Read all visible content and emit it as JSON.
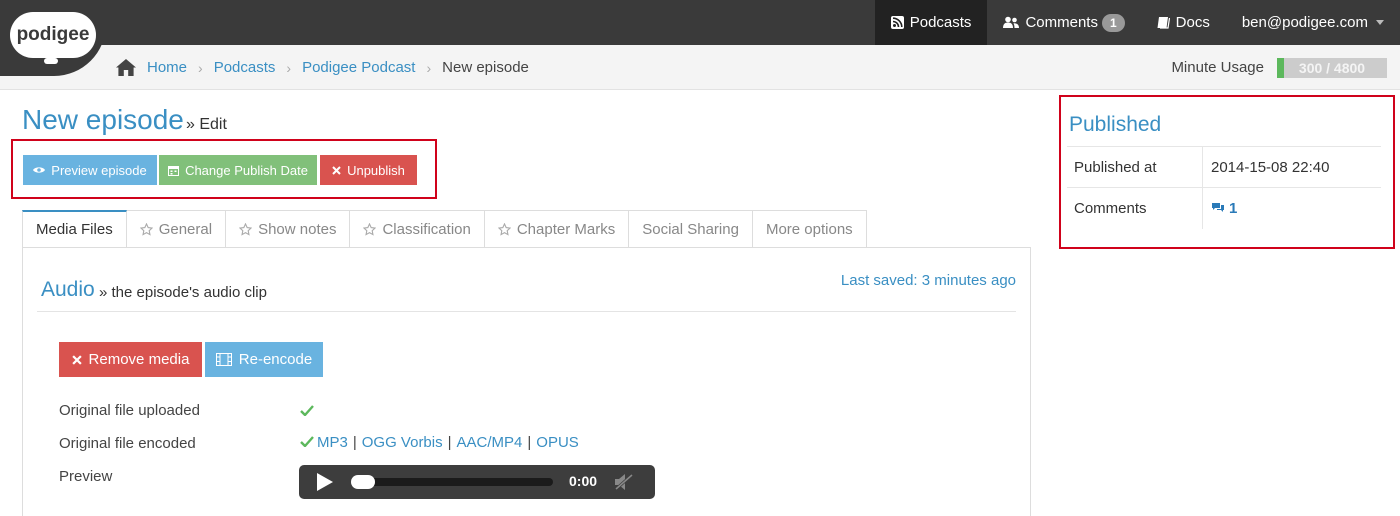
{
  "app": {
    "logo_text": "podigee"
  },
  "topnav": {
    "items": [
      {
        "label": "Podcasts",
        "icon": "rss-icon",
        "active": true
      },
      {
        "label": "Comments",
        "icon": "users-icon",
        "badge": "1"
      },
      {
        "label": "Docs",
        "icon": "book-icon"
      },
      {
        "label": "ben@podigee.com",
        "icon": "caret-down-icon"
      }
    ]
  },
  "breadcrumb": {
    "home_icon": "home-icon",
    "items": [
      "Home",
      "Podcasts",
      "Podigee Podcast"
    ],
    "current": "New episode",
    "separator": "›"
  },
  "usage": {
    "label": "Minute Usage",
    "value": "300 / 4800",
    "fraction": 0.0625,
    "color": "#5cb85c"
  },
  "page": {
    "title": "New episode",
    "subtitle": "» Edit"
  },
  "actions": {
    "preview": {
      "label": "Preview episode",
      "icon": "eye-icon"
    },
    "change_date": {
      "label": "Change Publish Date",
      "icon": "calendar-icon"
    },
    "unpublish": {
      "label": "Unpublish",
      "icon": "times-icon"
    }
  },
  "tabs": [
    {
      "label": "Media Files",
      "active": true
    },
    {
      "label": "General",
      "icon": "star-icon"
    },
    {
      "label": "Show notes",
      "icon": "star-icon"
    },
    {
      "label": "Classification",
      "icon": "star-icon"
    },
    {
      "label": "Chapter Marks",
      "icon": "star-icon"
    },
    {
      "label": "Social Sharing"
    },
    {
      "label": "More options"
    }
  ],
  "audio": {
    "title": "Audio",
    "subtitle": "» the episode's audio clip",
    "last_saved": "Last saved: 3 minutes ago",
    "remove_label": "Remove media",
    "reencode_label": "Re-encode",
    "rows": {
      "uploaded": "Original file uploaded",
      "encoded": "Original file encoded",
      "preview": "Preview"
    },
    "formats": [
      "MP3",
      "OGG Vorbis",
      "AAC/MP4",
      "OPUS"
    ],
    "player_time": "0:00"
  },
  "published": {
    "title": "Published",
    "published_at_label": "Published at",
    "published_at_value": "2014-15-08 22:40",
    "comments_label": "Comments",
    "comments_value": "1"
  },
  "colors": {
    "accent": "#3a8fc3",
    "danger": "#d9534f",
    "success": "#81c07a",
    "info": "#69b3e0",
    "highlight": "#d0021b"
  }
}
